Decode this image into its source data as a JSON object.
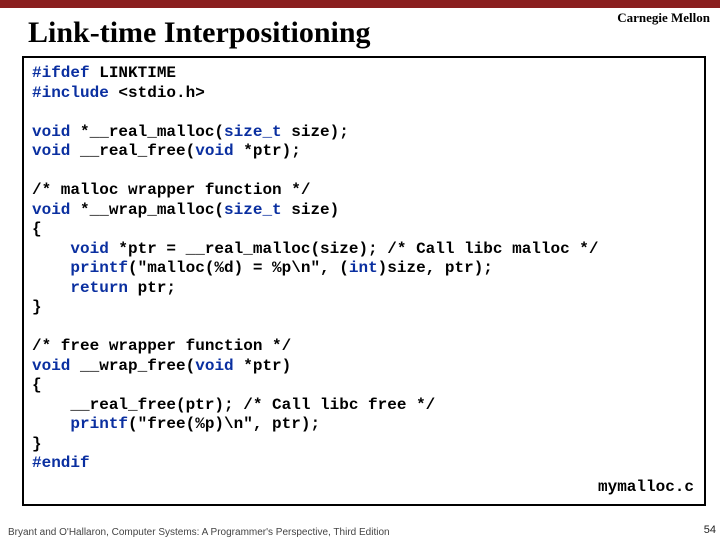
{
  "brand": "Carnegie Mellon",
  "title": "Link-time Interpositioning",
  "code": {
    "l1a": "#ifdef",
    "l1b": " LINKTIME",
    "l2a": "#include",
    "l2b": " <stdio.h>",
    "blank1": "",
    "l3a": "void",
    "l3b": " *__real_malloc(",
    "l3c": "size_t",
    "l3d": " size);",
    "l4a": "void",
    "l4b": " __real_free(",
    "l4c": "void",
    "l4d": " *ptr);",
    "blank2": "",
    "l5": "/* malloc wrapper function */",
    "l6a": "void",
    "l6b": " *__wrap_malloc(",
    "l6c": "size_t",
    "l6d": " size)",
    "l7": "{",
    "l8a": "    void",
    "l8b": " *ptr = __real_malloc(size); ",
    "l8c": "/* Call libc malloc */",
    "l9a": "    printf",
    "l9b": "(\"malloc(%d) = %p\\n\", (",
    "l9c": "int",
    "l9d": ")size, ptr);",
    "l10a": "    return",
    "l10b": " ptr;",
    "l11": "}",
    "blank3": "",
    "l12": "/* free wrapper function */",
    "l13a": "void",
    "l13b": " __wrap_free(",
    "l13c": "void",
    "l13d": " *ptr)",
    "l14": "{",
    "l15a": "    __real_free(ptr); ",
    "l15b": "/* Call libc free */",
    "l16a": "    printf",
    "l16b": "(\"free(%p)\\n\", ptr);",
    "l17": "}",
    "l18a": "#endif"
  },
  "filename": "mymalloc.c",
  "footer": "Bryant and O'Hallaron, Computer Systems: A Programmer's Perspective, Third Edition",
  "pagenum": "54"
}
